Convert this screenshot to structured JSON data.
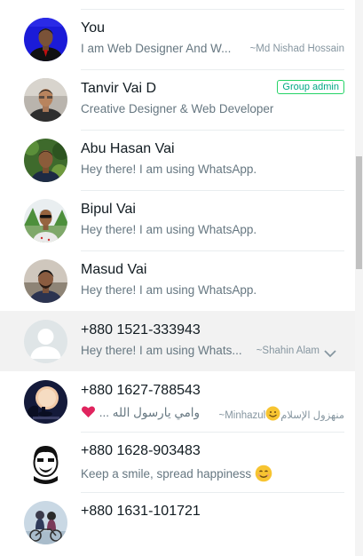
{
  "participants": [
    {
      "name": "You",
      "status": "I am Web Designer And W...",
      "aside": "~Md Nishad Hossain",
      "avatar": "profile-photo-you"
    },
    {
      "name": "Tanvir Vai D",
      "status": "Creative Designer & Web Developer",
      "badge": "Group admin",
      "avatar": "profile-photo-tanvir"
    },
    {
      "name": "Abu Hasan Vai",
      "status": "Hey there! I am using WhatsApp.",
      "avatar": "profile-photo-abu-hasan"
    },
    {
      "name": "Bipul Vai",
      "status": "Hey there! I am using WhatsApp.",
      "avatar": "profile-photo-bipul"
    },
    {
      "name": "Masud Vai",
      "status": "Hey there! I am using WhatsApp.",
      "avatar": "profile-photo-masud"
    },
    {
      "name": "+880 1521-333943",
      "status": "Hey there! I am using Whats...",
      "aside": "~Shahin Alam",
      "avatar": "default-avatar-icon"
    },
    {
      "name": "+880 1627-788543",
      "status": "وامي يارسول الله ...",
      "status_emoji": "heart-emoji",
      "aside_prefix": "~Minhazul",
      "aside_suffix": "منهزول الإسلام",
      "aside_emoji": "smile-emoji",
      "avatar": "profile-photo-night-scene"
    },
    {
      "name": "+880 1628-903483",
      "status": "Keep a smile, spread happiness",
      "status_emoji": "smile-emoji",
      "avatar": "profile-photo-cartoon"
    },
    {
      "name": "+880 1631-101721",
      "avatar": "profile-photo-couple-illustration"
    }
  ],
  "colors": {
    "accent": "#00a884",
    "admin_border": "#25d366",
    "hover_bg": "#f2f2f2",
    "name": "#111b21",
    "secondary": "#667781"
  },
  "icons": {
    "row_menu": "chevron-down-icon"
  }
}
